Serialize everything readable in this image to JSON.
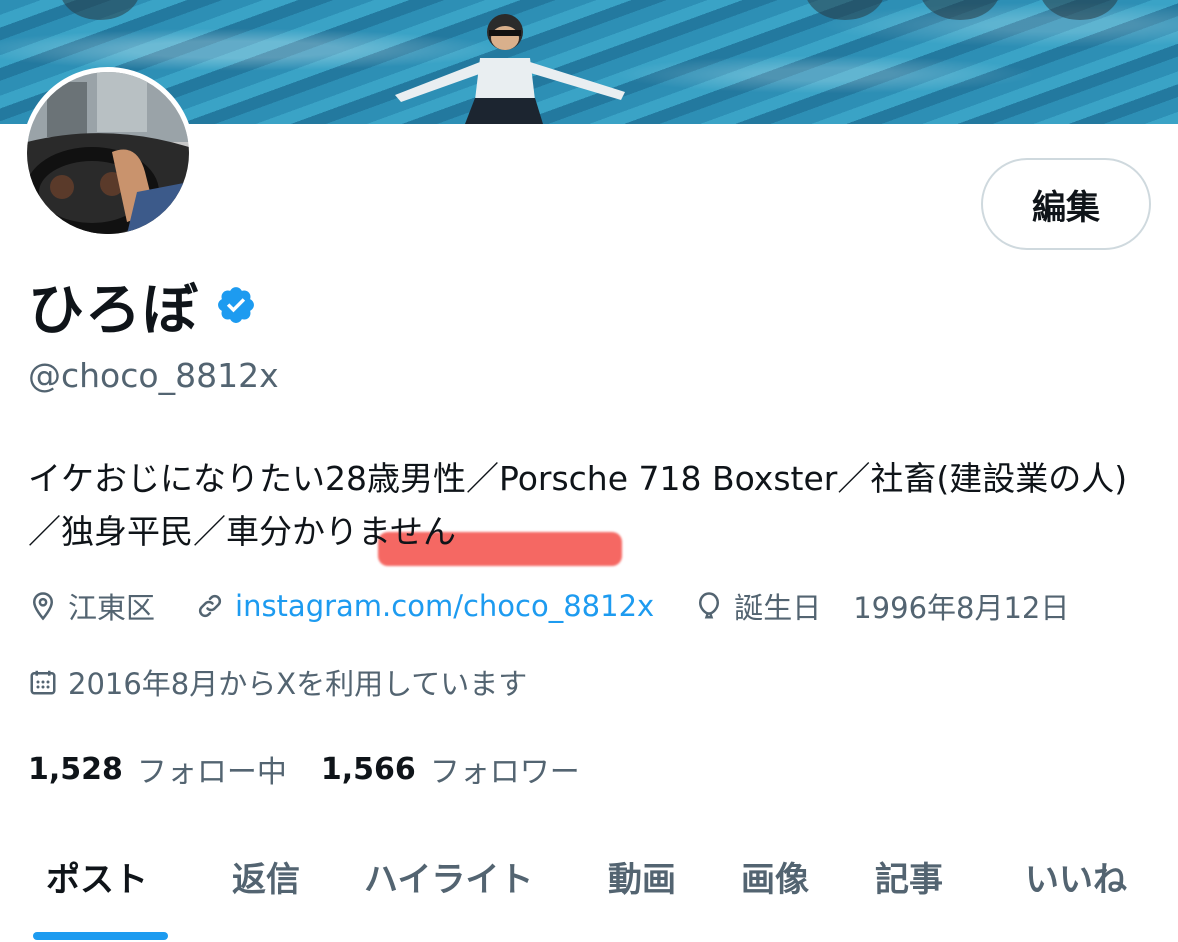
{
  "profile": {
    "display_name": "ひろぼ",
    "handle": "@choco_8812x",
    "edit_label": "編集",
    "bio_main": "イケおじになりたい28歳男性／Porsche 718 Boxster／社畜(建設業の人)／独身平民／",
    "bio_highlight": "車分かりません",
    "location": "江東区",
    "link": "instagram.com/choco_8812x",
    "birthday_label": "誕生日",
    "birthday": "1996年8月12日",
    "joined": "2016年8月からXを利用しています",
    "following_count": "1,528",
    "following_label": "フォロー中",
    "followers_count": "1,566",
    "followers_label": "フォロワー"
  },
  "tabs": [
    {
      "label": "ポスト",
      "active": true
    },
    {
      "label": "返信",
      "active": false
    },
    {
      "label": "ハイライト",
      "active": false
    },
    {
      "label": "動画",
      "active": false
    },
    {
      "label": "画像",
      "active": false
    },
    {
      "label": "記事",
      "active": false
    },
    {
      "label": "いいね",
      "active": false
    }
  ],
  "colors": {
    "accent": "#1d9bf0",
    "secondary_text": "#536471",
    "highlight_marker": "#f2362f"
  },
  "icons": {
    "location": "map-pin-icon",
    "link": "link-icon",
    "birthday": "balloon-icon",
    "joined": "calendar-icon",
    "verified": "verified-badge-icon"
  }
}
